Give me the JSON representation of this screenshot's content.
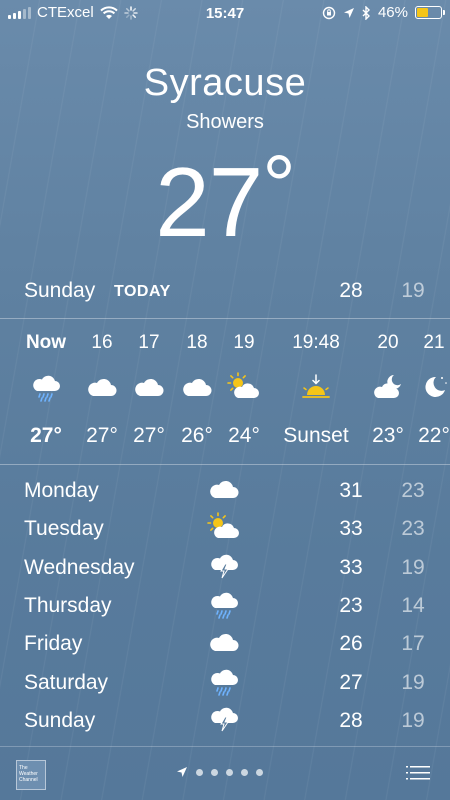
{
  "status_bar": {
    "carrier": "CTExcel",
    "time": "15:47",
    "battery": "46%",
    "battery_level": 0.46,
    "battery_color": "#f5c518"
  },
  "location": {
    "city": "Syracuse",
    "condition": "Showers",
    "temperature": "27",
    "degree": "°"
  },
  "today": {
    "day": "Sunday",
    "label": "TODAY",
    "high": "28",
    "low": "19"
  },
  "hourly": [
    {
      "time": "Now",
      "icon": "rain-cloud-icon",
      "temp": "27°"
    },
    {
      "time": "16",
      "icon": "cloud-icon",
      "temp": "27°"
    },
    {
      "time": "17",
      "icon": "cloud-icon",
      "temp": "27°"
    },
    {
      "time": "18",
      "icon": "cloud-icon",
      "temp": "26°"
    },
    {
      "time": "19",
      "icon": "sun-cloud-icon",
      "temp": "24°"
    },
    {
      "time": "19:48",
      "icon": "sunset-icon",
      "temp": "Sunset"
    },
    {
      "time": "20",
      "icon": "moon-cloud-icon",
      "temp": "23°"
    },
    {
      "time": "21",
      "icon": "moon-icon",
      "temp": "22°"
    }
  ],
  "daily": [
    {
      "day": "Monday",
      "icon": "cloud-icon",
      "high": "31",
      "low": "23"
    },
    {
      "day": "Tuesday",
      "icon": "sun-cloud-icon",
      "high": "33",
      "low": "23"
    },
    {
      "day": "Wednesday",
      "icon": "thunderstorm-icon",
      "high": "33",
      "low": "19"
    },
    {
      "day": "Thursday",
      "icon": "rain-cloud-icon",
      "high": "23",
      "low": "14"
    },
    {
      "day": "Friday",
      "icon": "cloud-icon",
      "high": "26",
      "low": "17"
    },
    {
      "day": "Saturday",
      "icon": "rain-cloud-icon",
      "high": "27",
      "low": "19"
    },
    {
      "day": "Sunday",
      "icon": "thunderstorm-icon",
      "high": "28",
      "low": "19"
    }
  ],
  "footer": {
    "logo_text": "The Weather Channel",
    "page_dots": 5
  },
  "colors": {
    "background": "#5f81a1",
    "sun": "#f5c518",
    "rain": "#6fb3ff"
  }
}
